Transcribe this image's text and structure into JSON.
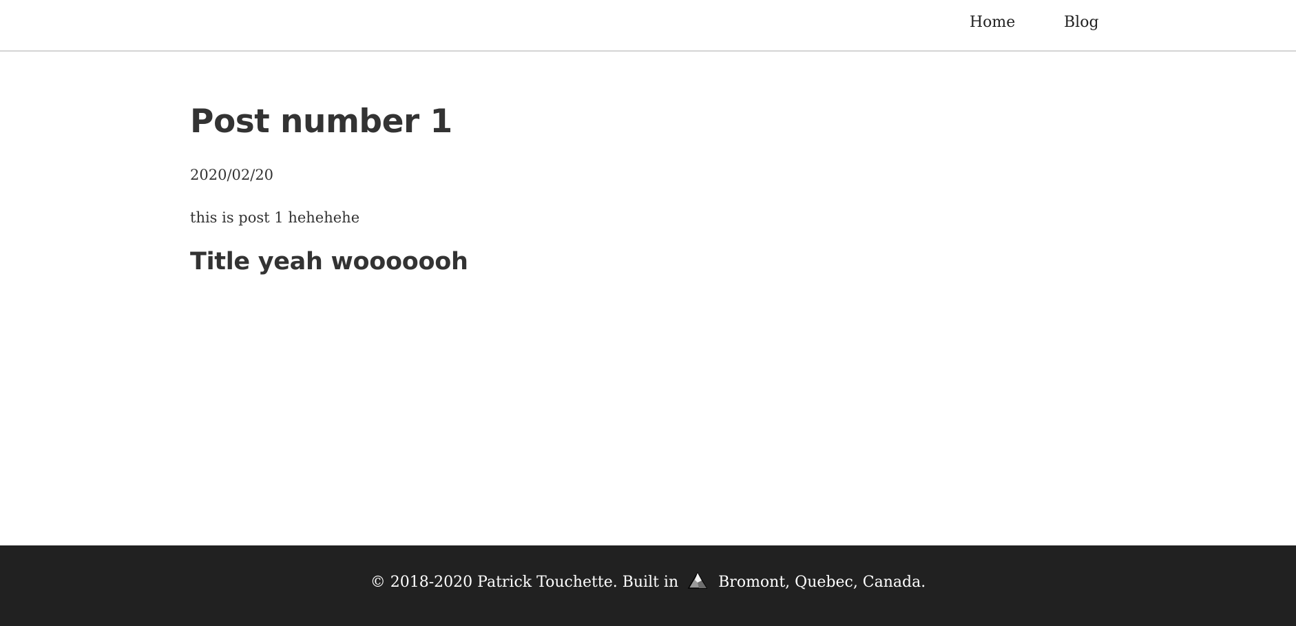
{
  "nav": {
    "items": [
      {
        "label": "Home"
      },
      {
        "label": "Blog"
      }
    ]
  },
  "post": {
    "title": "Post number 1",
    "date": "2020/02/20",
    "body": "this is post 1 hehehehe",
    "subtitle": "Title yeah wooooooh"
  },
  "footer": {
    "text_before": "© 2018-2020 Patrick Touchette. Built in",
    "icon": "mountain-icon",
    "text_after": "Bromont, Quebec, Canada."
  },
  "colors": {
    "text": "#333333",
    "footer_bg": "#212121",
    "footer_text": "#ffffff",
    "nav_border": "#d4d4d4"
  }
}
